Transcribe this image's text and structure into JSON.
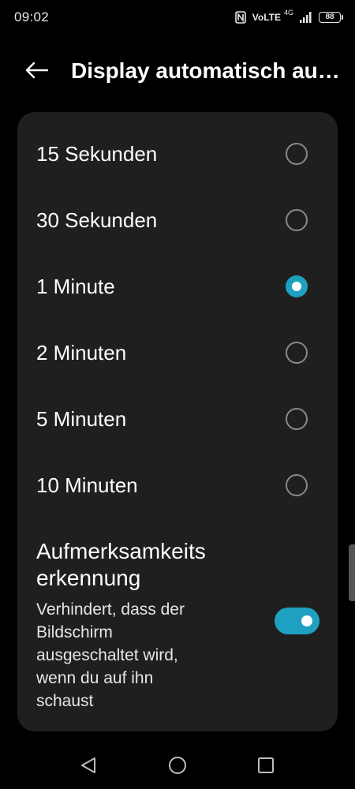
{
  "status_bar": {
    "time": "09:02",
    "nfc_icon": "nfc-icon",
    "volte": "VoLTE",
    "network_type": "4G",
    "battery_level": "88"
  },
  "app_bar": {
    "back_icon": "arrow-left-icon",
    "title": "Display automatisch ausschalten"
  },
  "options": [
    {
      "label": "15 Sekunden",
      "selected": false
    },
    {
      "label": "30 Sekunden",
      "selected": false
    },
    {
      "label": "1 Minute",
      "selected": true
    },
    {
      "label": "2 Minuten",
      "selected": false
    },
    {
      "label": "5 Minuten",
      "selected": false
    },
    {
      "label": "10 Minuten",
      "selected": false
    }
  ],
  "attention_detection": {
    "title_line1": "Aufmerksamkeits",
    "title_line2": "erkennung",
    "description_lines": [
      "Verhindert, dass der",
      "Bildschirm",
      "ausgeschaltet wird,",
      "wenn du auf ihn",
      "schaust"
    ],
    "toggle_on": true
  },
  "colors": {
    "accent": "#1ea1c0",
    "background": "#000000",
    "card": "#1f1f1f"
  },
  "nav_bar": {
    "back": "triangle-back-icon",
    "home": "circle-home-icon",
    "recents": "square-recents-icon"
  }
}
